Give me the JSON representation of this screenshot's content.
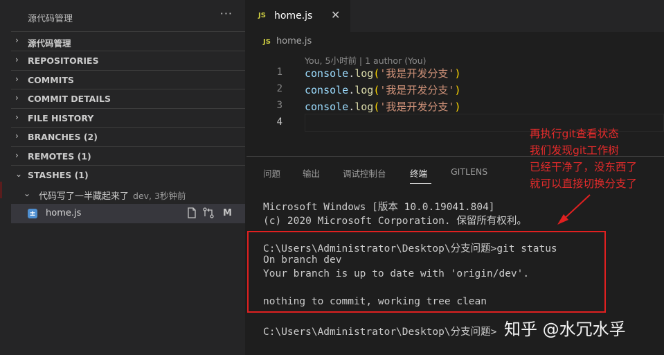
{
  "sidebar": {
    "title": "源代码管理",
    "more": "···",
    "sections": [
      {
        "chev": "›",
        "label": "源代码管理"
      },
      {
        "chev": "›",
        "label": "REPOSITORIES"
      },
      {
        "chev": "›",
        "label": "COMMITS"
      },
      {
        "chev": "›",
        "label": "COMMIT DETAILS"
      },
      {
        "chev": "›",
        "label": "FILE HISTORY"
      },
      {
        "chev": "›",
        "label": "BRANCHES (2)"
      },
      {
        "chev": "›",
        "label": "REMOTES (1)"
      },
      {
        "chev": "⌄",
        "label": "STASHES (1)"
      }
    ],
    "stash": {
      "label": "代码写了一半藏起来了",
      "desc": "dev, 3秒钟前"
    },
    "file": {
      "icon_glyph": "±",
      "name": "home.js",
      "status": "M",
      "icons": [
        "open-file-icon",
        "compare-changes-icon"
      ]
    }
  },
  "editor": {
    "tab": {
      "icon": "JS",
      "name": "home.js",
      "close": "✕"
    },
    "breadcrumb": {
      "icon": "JS",
      "name": "home.js"
    },
    "blame": "You, 5小时前 | 1 author (You)",
    "lines": [
      {
        "num": "1",
        "obj": "console",
        "dot": ".",
        "fn": "log",
        "open": "(",
        "str": "'我是开发分支'",
        "close": ")"
      },
      {
        "num": "2",
        "obj": "console",
        "dot": ".",
        "fn": "log",
        "open": "(",
        "str": "'我是开发分支'",
        "close": ")"
      },
      {
        "num": "3",
        "obj": "console",
        "dot": ".",
        "fn": "log",
        "open": "(",
        "str": "'我是开发分支'",
        "close": ")"
      },
      {
        "num": "4"
      }
    ]
  },
  "panel": {
    "tabs": [
      "问题",
      "输出",
      "调试控制台",
      "终端",
      "GITLENS"
    ],
    "active_tab": "终端",
    "terminal": [
      "Microsoft Windows [版本 10.0.19041.804]",
      "(c) 2020 Microsoft Corporation. 保留所有权利。",
      "C:\\Users\\Administrator\\Desktop\\分支问题>git status",
      "On branch dev",
      "Your branch is up to date with 'origin/dev'.",
      "nothing to commit, working tree clean",
      "C:\\Users\\Administrator\\Desktop\\分支问题>"
    ]
  },
  "annotation": {
    "lines": [
      "再执行git查看状态",
      "我们发现git工作树",
      "已经干净了，没东西了",
      "就可以直接切换分支了"
    ],
    "color": "#e32b2b"
  },
  "watermark": "知乎 @水冗水孚"
}
